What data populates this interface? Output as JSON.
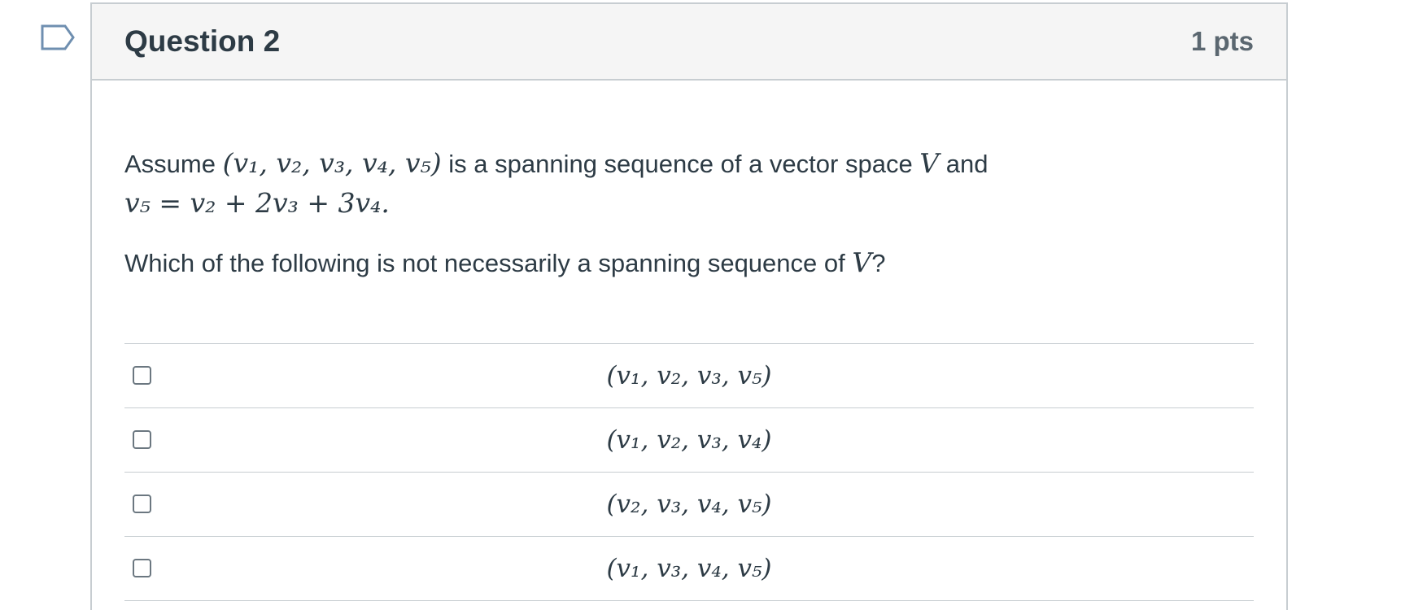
{
  "question": {
    "title": "Question 2",
    "points": "1 pts",
    "stem": {
      "intro_text": "Assume ",
      "sequence": "(v₁, v₂, v₃, v₄, v₅)",
      "mid_text": " is a spanning sequence of a vector space ",
      "space": "V",
      "end_text": " and",
      "equation": "v₅ = v₂ + 2v₃ + 3v₄."
    },
    "prompt": {
      "text": "Which of the following is not necessarily a spanning sequence of ",
      "space": "V",
      "end": "?"
    },
    "answers": [
      {
        "label": "(v₁, v₂, v₃, v₅)",
        "checked": false
      },
      {
        "label": "(v₁, v₂, v₃, v₄)",
        "checked": false
      },
      {
        "label": "(v₂, v₃, v₄, v₅)",
        "checked": false
      },
      {
        "label": "(v₁, v₃, v₄, v₅)",
        "checked": false
      }
    ]
  },
  "icons": {
    "flag": "bookmark-flag-icon"
  },
  "colors": {
    "header_bg": "#f5f5f5",
    "border": "#c7cdd1",
    "text": "#2d3b45",
    "flag_stroke": "#6f8fb0"
  }
}
